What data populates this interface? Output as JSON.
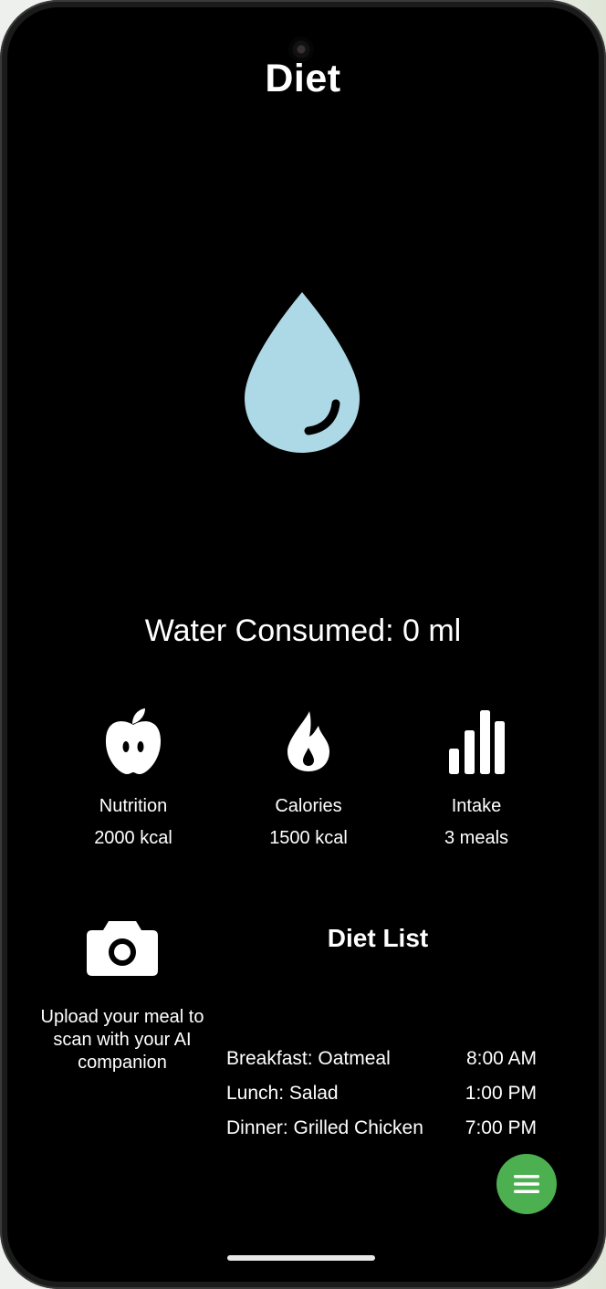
{
  "header": {
    "title": "Diet"
  },
  "water": {
    "consumed_text": "Water Consumed: 0 ml",
    "drop_color": "#ADD8E6"
  },
  "stats": [
    {
      "icon": "apple-icon",
      "label": "Nutrition",
      "value": "2000 kcal"
    },
    {
      "icon": "flame-icon",
      "label": "Calories",
      "value": "1500 kcal"
    },
    {
      "icon": "bar-chart-icon",
      "label": "Intake",
      "value": "3 meals"
    }
  ],
  "upload": {
    "icon": "camera-icon",
    "text": "Upload your meal to scan with your AI companion"
  },
  "diet_list": {
    "title": "Diet List",
    "meals": [
      {
        "name": "Breakfast: Oatmeal",
        "time": "8:00 AM"
      },
      {
        "name": "Lunch: Salad",
        "time": "1:00 PM"
      },
      {
        "name": "Dinner: Grilled Chicken",
        "time": "7:00 PM"
      }
    ]
  },
  "fab": {
    "icon": "menu-icon",
    "color": "#4CAF50"
  }
}
